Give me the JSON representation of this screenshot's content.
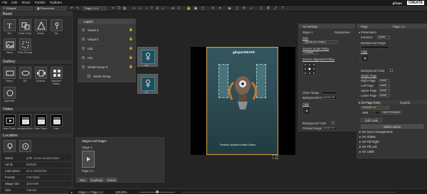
{
  "menu": {
    "items": [
      "File",
      "Edit",
      "Share",
      "Publish",
      "Toolbars"
    ],
    "brand_main": "glispa",
    "brand_accent": "CREATE"
  },
  "toolbar": {
    "widgets_tab": "Widgets",
    "resources_tab": "Resources",
    "page_selector": "Page 1.1",
    "ad_settings_label": "Ad Settings"
  },
  "left": {
    "basic_title": "Basic",
    "basic_widgets": [
      "Text",
      "Smart Group",
      "Shape",
      "Tap",
      "Visual",
      "Press Through"
    ],
    "gallery_title": "Gallery",
    "gallery_widgets": [
      "Gallery",
      "360",
      "Carousel",
      "Advanced Gallery",
      "Appended"
    ],
    "video_title": "Video",
    "video_widgets": [
      "Video Player",
      "Animated Birds",
      "Video Player",
      "Video"
    ],
    "location_title": "Location",
    "props": [
      {
        "key": "Name",
        "value": "pribt: move around dane"
      },
      {
        "key": "Ad ID",
        "value": "600008"
      },
      {
        "key": "Last saved",
        "value": "20.2.4/25/2019"
      },
      {
        "key": "Format",
        "value": "Interstitial"
      },
      {
        "key": "Stage size",
        "value": "320X480"
      },
      {
        "key": "Size",
        "value": "748 KB"
      }
    ]
  },
  "layers": {
    "title": "Layers",
    "rows": [
      "Visual 4",
      "Visual 5",
      "rot2",
      "rot1",
      "Smart Group 3",
      "Smart Group"
    ]
  },
  "thumbs": [
    "rot2",
    "rot1"
  ],
  "stages": {
    "title": "Stages And Pages",
    "stage": "Stage 1",
    "page": "Page 1.1",
    "buttons": [
      "New",
      "Duplicate",
      "Delete"
    ]
  },
  "canvas": {
    "brand": "glispaCREATE",
    "caption": "Particle Update Emitter Demo",
    "coords": "X: 302\nY: 401"
  },
  "ad_settings": {
    "stage_name": "Stage 1",
    "responsive": "Responsive",
    "size_label": "Size",
    "size_value": "Typical (320X480)",
    "scale_policy_label": "Screen Scale Policy",
    "scale_policy_value": "Contain",
    "alignment_label": "Screen Alignment Policy",
    "close_image": "Close image",
    "bg_image": "Background image",
    "bg_image_hint": "upload file",
    "align_label": "Align",
    "bg_color": "Background Color",
    "preload_image": "Preload image",
    "preload_hint": "upload file"
  },
  "page_panel": {
    "title": "Page",
    "page_name": "Page 1.1",
    "parameters": "Parameters",
    "entrance": "Entrance",
    "entrance_value": "None",
    "bg_image": "Background image",
    "align": "Align",
    "bg_color": "Background Color",
    "swipe_page": "Swipe Page",
    "right_page": "Right Page",
    "left_page": "Left Page",
    "upper_page": "Upper Page",
    "lower_page": "Lower Page",
    "none": "None",
    "on_page_entry": "On Page Entry",
    "expand": "Expand",
    "execute": "Execute JS",
    "wait": "Wait",
    "wait_value": "1",
    "wait_unit": "With Previous",
    "edit_code": "Edit Code",
    "select_action": "Select action",
    "events": [
      "On Gyro Unsupported",
      "On Shake",
      "On Tilt Right",
      "On Tilt Left",
      "On Untilt"
    ]
  },
  "bottom": {
    "stage": "Stage 1 / Page 1.1",
    "zoom": "100.00%"
  }
}
